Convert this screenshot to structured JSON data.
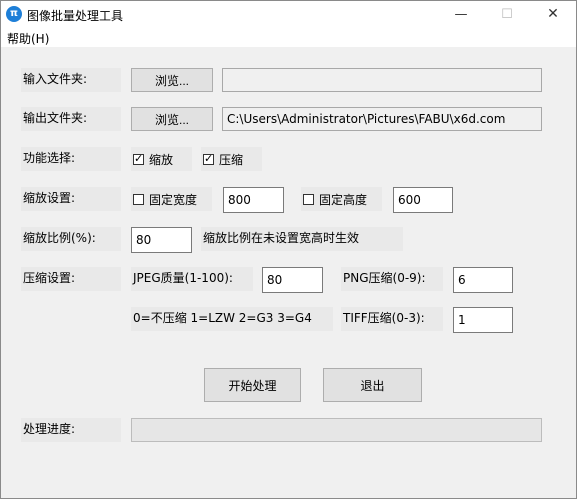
{
  "window": {
    "title": "图像批量处理工具",
    "app_icon_glyph": "π",
    "accent_color": "#1e7fd8"
  },
  "menu": {
    "help": "帮助(H)"
  },
  "input_folder": {
    "label": "输入文件夹:",
    "browse_label": "浏览...",
    "path": ""
  },
  "output_folder": {
    "label": "输出文件夹:",
    "browse_label": "浏览...",
    "path": "C:\\Users\\Administrator\\Pictures\\FABU\\x6d.com"
  },
  "function": {
    "label": "功能选择:",
    "scale_label": "缩放",
    "scale_checked": true,
    "compress_label": "压缩",
    "compress_checked": true
  },
  "scale_settings": {
    "label": "缩放设置:",
    "fixed_width_label": "固定宽度",
    "fixed_width_checked": false,
    "width_value": "800",
    "fixed_height_label": "固定高度",
    "fixed_height_checked": false,
    "height_value": "600"
  },
  "scale_ratio": {
    "label": "缩放比例(%):",
    "value": "80",
    "hint": "缩放比例在未设置宽高时生效"
  },
  "compress_settings": {
    "label": "压缩设置:",
    "jpeg_label": "JPEG质量(1-100):",
    "jpeg_value": "80",
    "png_label": "PNG压缩(0-9):",
    "png_value": "6",
    "tiff_hint": "0=不压缩 1=LZW 2=G3 3=G4",
    "tiff_label": "TIFF压缩(0-3):",
    "tiff_value": "1"
  },
  "actions": {
    "start_label": "开始处理",
    "exit_label": "退出"
  },
  "progress": {
    "label": "处理进度:",
    "value_percent": 0
  }
}
